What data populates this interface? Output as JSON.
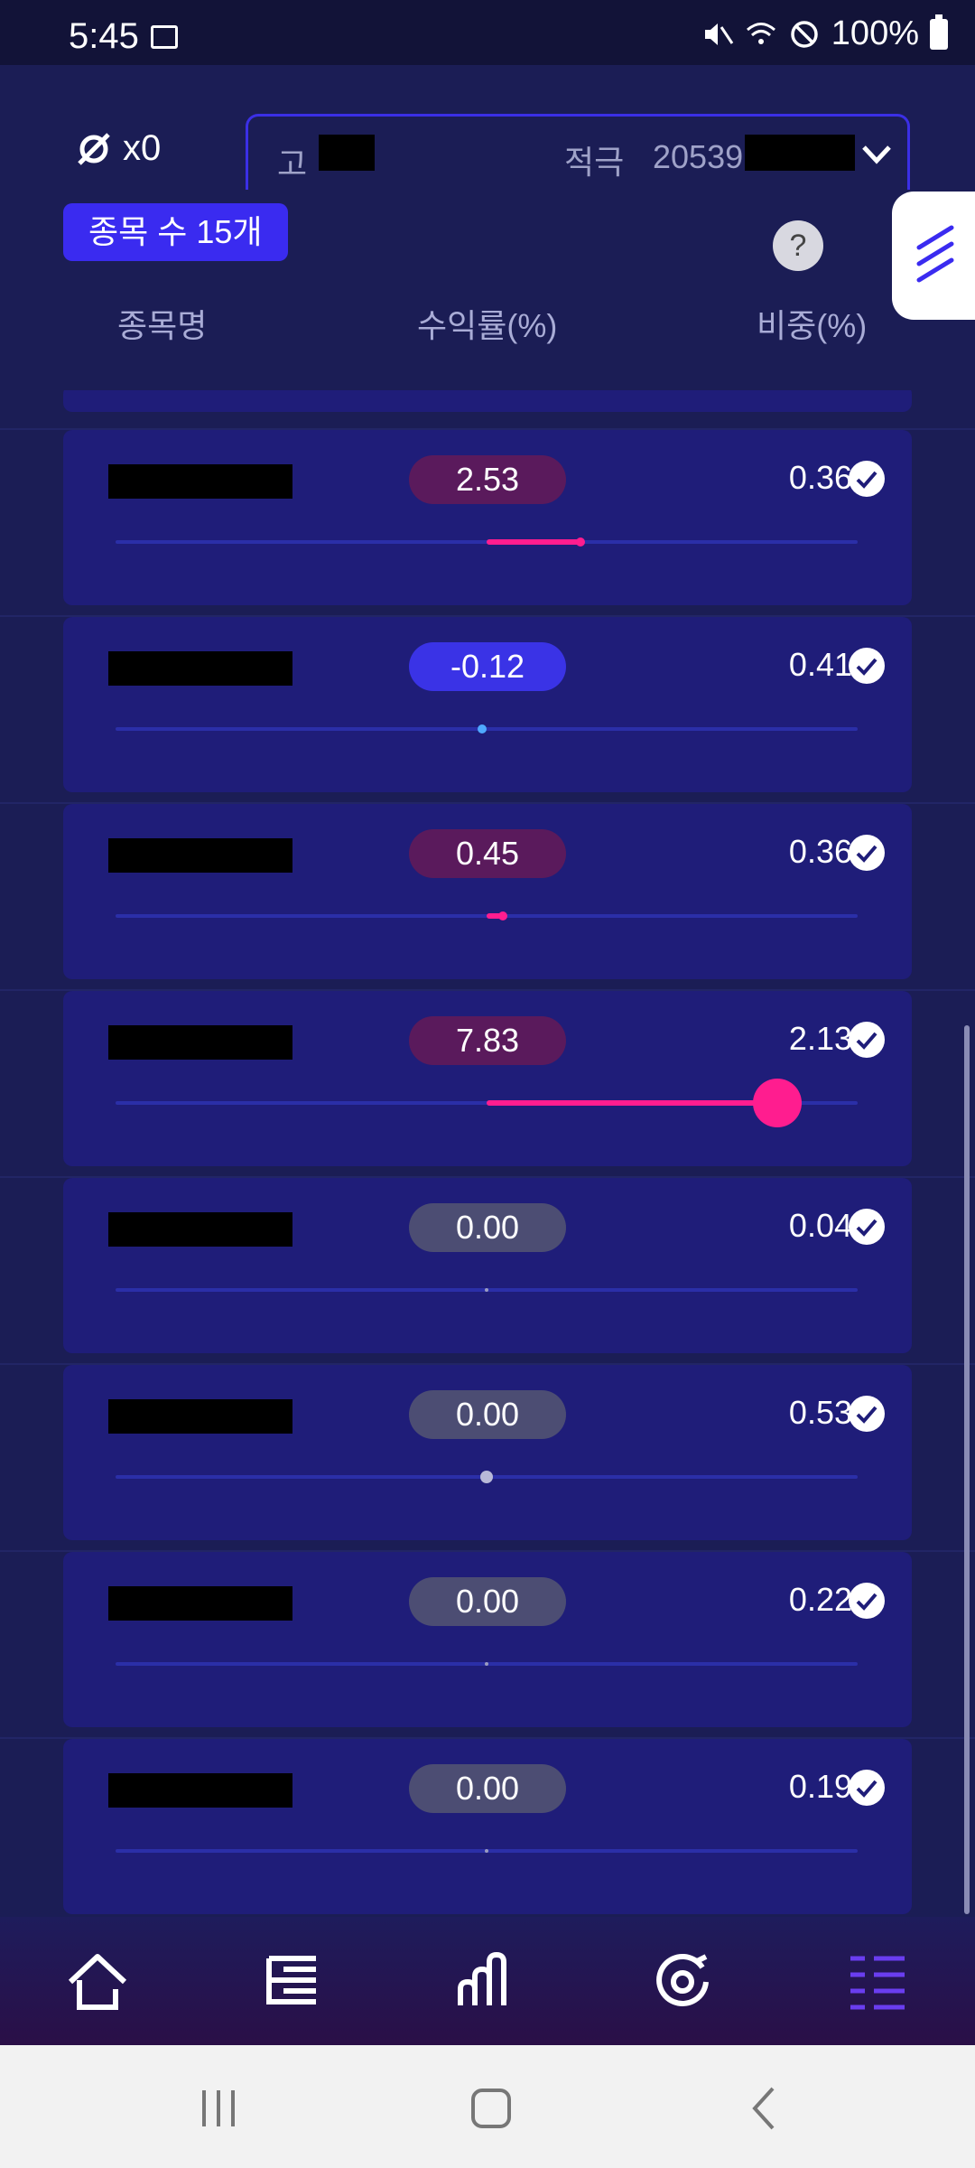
{
  "status_bar": {
    "time": "5:45",
    "battery": "100%"
  },
  "header": {
    "multiplier": "x0",
    "account": {
      "type": "고",
      "label": "적극",
      "number": "20539"
    },
    "stock_count": "종목 수 15개",
    "help": "?"
  },
  "columns": {
    "name": "종목명",
    "return": "수익률(%)",
    "weight": "비중(%)"
  },
  "rows": [
    {
      "return": "2.53",
      "weight": "0.36",
      "sign": "pos",
      "level": 2.53
    },
    {
      "return": "-0.12",
      "weight": "0.41",
      "sign": "neg",
      "level": -0.12
    },
    {
      "return": "0.45",
      "weight": "0.36",
      "sign": "pos",
      "level": 0.45
    },
    {
      "return": "7.83",
      "weight": "2.13",
      "sign": "pos",
      "level": 7.83
    },
    {
      "return": "0.00",
      "weight": "0.04",
      "sign": "zero",
      "level": 0.0
    },
    {
      "return": "0.00",
      "weight": "0.53",
      "sign": "zero",
      "level": 0.0
    },
    {
      "return": "0.00",
      "weight": "0.22",
      "sign": "zero",
      "level": 0.0
    },
    {
      "return": "0.00",
      "weight": "0.19",
      "sign": "zero",
      "level": 0.0
    }
  ],
  "nav": {
    "items": [
      "home-icon",
      "list-icon",
      "chart-icon",
      "target-icon",
      "menu-icon"
    ],
    "active": "menu-icon"
  },
  "colors": {
    "accent": "#3a2bf0",
    "positive": "#ff1d8f",
    "negative": "#4fa9ff",
    "background": "#1b1d55"
  }
}
